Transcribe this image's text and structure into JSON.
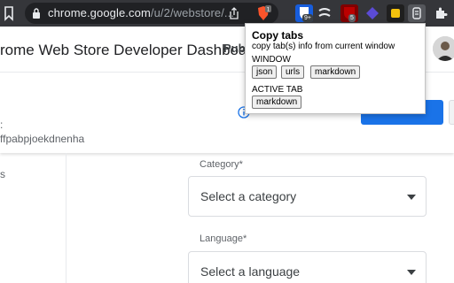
{
  "browser": {
    "url_host": "chrome.google.com",
    "url_path": "/u/2/webstore/...",
    "extensions": [
      {
        "name": "bitwarden-icon",
        "badge": "9+"
      },
      {
        "name": "extension-icon"
      },
      {
        "name": "ublock-icon",
        "badge": "5"
      },
      {
        "name": "extension-icon-purple"
      },
      {
        "name": "extension-icon-yellow"
      },
      {
        "name": "copy-tabs-icon"
      },
      {
        "name": "puzzle-icon"
      }
    ]
  },
  "page": {
    "title": "rome Web Store Developer Dashboard",
    "title_suffix": "Publ",
    "item_id_label": ":",
    "item_id": "ffpabpjoekdnenha",
    "sidenav_fragment": "s",
    "category": {
      "label": "Category*",
      "placeholder": "Select a category"
    },
    "language": {
      "label": "Language*",
      "placeholder": "Select a language"
    }
  },
  "popup": {
    "title": "Copy tabs",
    "description": "copy tab(s) info from current window",
    "window_section": "WINDOW",
    "window_buttons": [
      "json",
      "urls",
      "markdown"
    ],
    "active_section": "ACTIVE TAB",
    "active_buttons": [
      "markdown"
    ]
  },
  "colors": {
    "toolbar": "#35363a",
    "accent": "#1a73e8"
  }
}
